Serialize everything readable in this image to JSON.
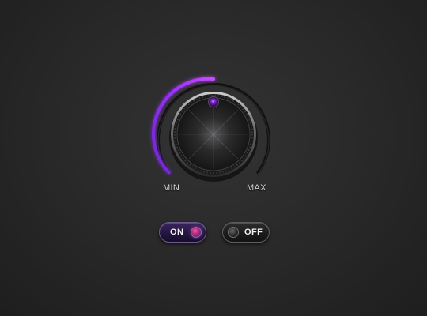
{
  "knob": {
    "min_label": "MIN",
    "max_label": "MAX",
    "level": 0.42,
    "accent_color": "#8a2be2"
  },
  "toggles": {
    "on_label": "ON",
    "off_label": "OFF",
    "on_state": true,
    "off_state": false
  },
  "icons": {
    "knob_indicator": "indicator-dot-icon",
    "toggle_on_dot": "on-dot-icon",
    "toggle_off_dot": "off-dot-icon"
  }
}
